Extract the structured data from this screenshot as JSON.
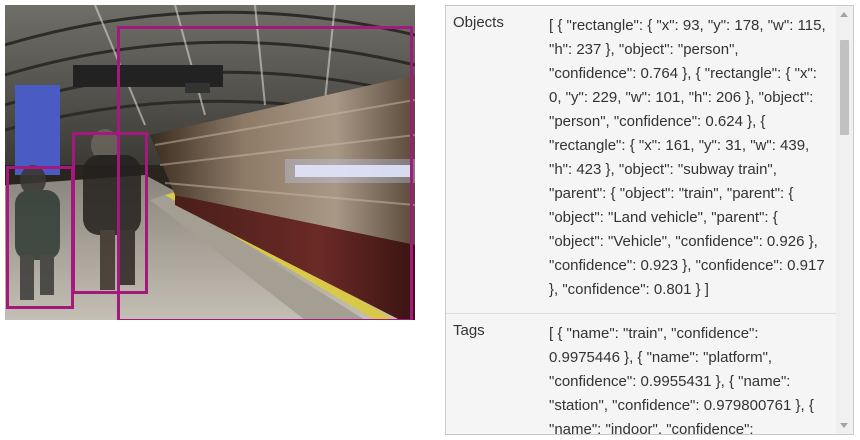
{
  "detections": [
    {
      "object": "person"
    },
    {
      "object": "person"
    },
    {
      "object": "subway train"
    }
  ],
  "results": {
    "objects": {
      "label": "Objects",
      "value": "[ { \"rectangle\": { \"x\": 93, \"y\": 178, \"w\": 115, \"h\": 237 }, \"object\": \"person\", \"confidence\": 0.764 }, { \"rectangle\": { \"x\": 0, \"y\": 229, \"w\": 101, \"h\": 206 }, \"object\": \"person\", \"confidence\": 0.624 }, { \"rectangle\": { \"x\": 161, \"y\": 31, \"w\": 439, \"h\": 423 }, \"object\": \"subway train\", \"parent\": { \"object\": \"train\", \"parent\": { \"object\": \"Land vehicle\", \"parent\": { \"object\": \"Vehicle\", \"confidence\": 0.926 }, \"confidence\": 0.923 }, \"confidence\": 0.917 }, \"confidence\": 0.801 } ]"
    },
    "tags": {
      "label": "Tags",
      "value": "[ { \"name\": \"train\", \"confidence\": 0.9975446 }, { \"name\": \"platform\", \"confidence\": 0.9955431 }, { \"name\": \"station\", \"confidence\": 0.979800761 }, { \"name\": \"indoor\", \"confidence\":"
    }
  },
  "colors": {
    "bounding_box": "#a5197e",
    "panel_background": "#f5f5f5",
    "panel_border": "#c9c9c9"
  }
}
